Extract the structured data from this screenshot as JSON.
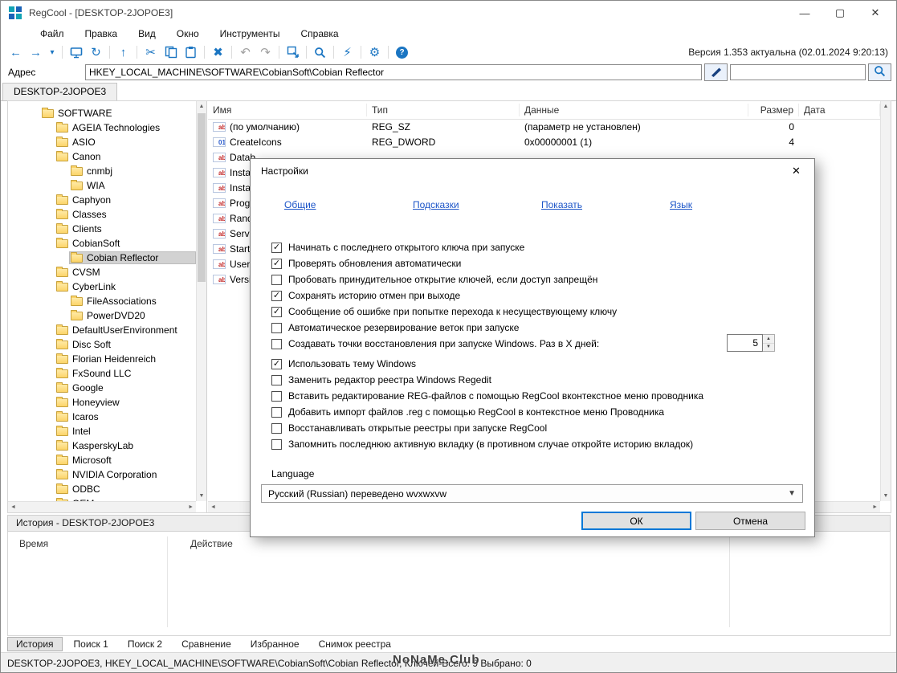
{
  "colors": {
    "toolbar_blue": "#1a75c2",
    "link_blue": "#1c55c8",
    "ok_border": "#0078d7",
    "folder_yellow": "#fcd469",
    "selection_gray": "#d2d2d2"
  },
  "window": {
    "title": "RegCool - [DESKTOP-2JOPOE3]",
    "version_text": "Версия 1.353 актуальна (02.01.2024 9:20:13)"
  },
  "menu": [
    "Файл",
    "Правка",
    "Вид",
    "Окно",
    "Инструменты",
    "Справка"
  ],
  "toolbar": {
    "icons": [
      "back",
      "forward",
      "chevron-down",
      "|",
      "monitor",
      "refresh",
      "|",
      "up",
      "|",
      "cut",
      "copy",
      "paste",
      "|",
      "delete",
      "|",
      "undo",
      "redo",
      "|",
      "export-window",
      "|",
      "search",
      "|",
      "lightning",
      "|",
      "gear",
      "|",
      "help"
    ],
    "disabled": [
      "undo",
      "redo"
    ]
  },
  "address": {
    "label": "Адрес",
    "value": "HKEY_LOCAL_MACHINE\\SOFTWARE\\CobianSoft\\Cobian Reflector"
  },
  "top_tabs": [
    "DESKTOP-2JOPOE3"
  ],
  "tree": {
    "items": [
      {
        "label": "SOFTWARE",
        "level": 0,
        "expanded": true
      },
      {
        "label": "AGEIA Technologies",
        "level": 1
      },
      {
        "label": "ASIO",
        "level": 1
      },
      {
        "label": "Canon",
        "level": 1,
        "expanded": true
      },
      {
        "label": "cnmbj",
        "level": 2
      },
      {
        "label": "WIA",
        "level": 2
      },
      {
        "label": "Caphyon",
        "level": 1
      },
      {
        "label": "Classes",
        "level": 1
      },
      {
        "label": "Clients",
        "level": 1
      },
      {
        "label": "CobianSoft",
        "level": 1,
        "expanded": true
      },
      {
        "label": "Cobian Reflector",
        "level": 2,
        "selected": true
      },
      {
        "label": "CVSM",
        "level": 1
      },
      {
        "label": "CyberLink",
        "level": 1,
        "expanded": true
      },
      {
        "label": "FileAssociations",
        "level": 2
      },
      {
        "label": "PowerDVD20",
        "level": 2
      },
      {
        "label": "DefaultUserEnvironment",
        "level": 1
      },
      {
        "label": "Disc Soft",
        "level": 1
      },
      {
        "label": "Florian Heidenreich",
        "level": 1
      },
      {
        "label": "FxSound LLC",
        "level": 1
      },
      {
        "label": "Google",
        "level": 1
      },
      {
        "label": "Honeyview",
        "level": 1
      },
      {
        "label": "Icaros",
        "level": 1
      },
      {
        "label": "Intel",
        "level": 1
      },
      {
        "label": "KasperskyLab",
        "level": 1
      },
      {
        "label": "Microsoft",
        "level": 1
      },
      {
        "label": "NVIDIA Corporation",
        "level": 1
      },
      {
        "label": "ODBC",
        "level": 1
      },
      {
        "label": "OEM",
        "level": 1
      }
    ]
  },
  "values": {
    "columns": [
      "Имя",
      "Тип",
      "Данные",
      "Размер",
      "Дата"
    ],
    "rows": [
      {
        "icon": "ab",
        "name": "(по умолчанию)",
        "type": "REG_SZ",
        "data": "(параметр не установлен)",
        "size": "0",
        "date": ""
      },
      {
        "icon": "01",
        "name": "CreateIcons",
        "type": "REG_DWORD",
        "data": "0x00000001 (1)",
        "size": "4",
        "date": ""
      },
      {
        "icon": "ab",
        "name": "Datab",
        "type": "",
        "data": "",
        "size": "",
        "date": ""
      },
      {
        "icon": "ab",
        "name": "Install",
        "type": "",
        "data": "",
        "size": "",
        "date": ""
      },
      {
        "icon": "ab",
        "name": "Install",
        "type": "",
        "data": "",
        "size": "",
        "date": ""
      },
      {
        "icon": "ab",
        "name": "Progr",
        "type": "",
        "data": "",
        "size": "",
        "date": ""
      },
      {
        "icon": "ab",
        "name": "Rando",
        "type": "",
        "data": "",
        "size": "",
        "date": ""
      },
      {
        "icon": "ab",
        "name": "Servic",
        "type": "",
        "data": "",
        "size": "",
        "date": ""
      },
      {
        "icon": "ab",
        "name": "StartU",
        "type": "",
        "data": "",
        "size": "",
        "date": ""
      },
      {
        "icon": "ab",
        "name": "UserN",
        "type": "",
        "data": "",
        "size": "",
        "date": ""
      },
      {
        "icon": "ab",
        "name": "Versio",
        "type": "",
        "data": "",
        "size": "",
        "date": ""
      }
    ]
  },
  "dialog": {
    "title": "Настройки",
    "tabs": [
      "Общие",
      "Подсказки",
      "Показать",
      "Язык"
    ],
    "checkboxes": [
      {
        "label": "Начинать с последнего открытого ключа при запуске",
        "checked": true
      },
      {
        "label": "Проверять обновления автоматически",
        "checked": true
      },
      {
        "label": "Пробовать принудительное открытие ключей, если доступ запрещён",
        "checked": false
      },
      {
        "label": "Сохранять историю отмен при выходе",
        "checked": true
      },
      {
        "label": "Сообщение об ошибке при попытке перехода к несуществующему ключу",
        "checked": true
      },
      {
        "label": "Автоматическое резервирование веток при запуске",
        "checked": false
      },
      {
        "label": "Создавать точки восстановления при запуске Windows. Раз в X дней:",
        "checked": false,
        "spinner": "5"
      },
      {
        "label": "Использовать тему Windows",
        "checked": true
      },
      {
        "label": "Заменить редактор реестра Windows Regedit",
        "checked": false
      },
      {
        "label": "Вставить редактирование REG-файлов с помощью RegCool вконтекстное меню проводника",
        "checked": false
      },
      {
        "label": "Добавить импорт файлов .reg с помощью RegCool в контекстное меню Проводника",
        "checked": false
      },
      {
        "label": "Восстанавливать открытые реестры при запуске RegCool",
        "checked": false
      },
      {
        "label": "Запомнить последнюю активную вкладку (в противном случае откройте историю вкладок)",
        "checked": false
      }
    ],
    "language_label": "Language",
    "language_value": "Русский (Russian) переведено wvxwxvw",
    "ok_label": "ОК",
    "cancel_label": "Отмена"
  },
  "history": {
    "title": "История - DESKTOP-2JOPOE3",
    "columns": [
      "Время",
      "Действие"
    ]
  },
  "bottom_tabs": [
    "История",
    "Поиск 1",
    "Поиск 2",
    "Сравнение",
    "Избранное",
    "Снимок реестра"
  ],
  "status": {
    "text": "DESKTOP-2JOPOE3, HKEY_LOCAL_MACHINE\\SOFTWARE\\CobianSoft\\Cobian Reflector, Ключей-Всего: 9  Выбрано: 0"
  },
  "watermark": "NoNaMe.Club"
}
